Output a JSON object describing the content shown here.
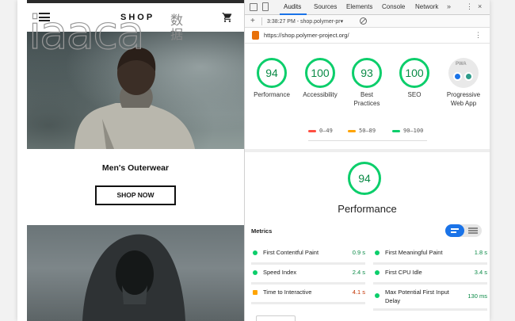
{
  "watermark": {
    "latin": "iaaca",
    "cn": "数\n据"
  },
  "shop": {
    "title": "SHOP",
    "product_name": "Men's Outerwear",
    "shop_now_label": "SHOP NOW"
  },
  "devtools": {
    "tabs": [
      "Audits",
      "Sources",
      "Elements",
      "Console",
      "Network"
    ],
    "more_tabs": "»",
    "menu": "⋮",
    "close": "×",
    "new_audit": "+",
    "audit_entry": "3:38:27 PM - shop.polymer-pr▾",
    "url": "https://shop.polymer-project.org/"
  },
  "scores": [
    {
      "label": "Performance",
      "value": "94"
    },
    {
      "label": "Accessibility",
      "value": "100"
    },
    {
      "label": "Best\nPractices",
      "value": "93"
    },
    {
      "label": "SEO",
      "value": "100"
    }
  ],
  "pwa": {
    "label": "Progressive\nWeb App",
    "badge": "PWA"
  },
  "legend": [
    {
      "range": "0–49",
      "color": "#ff4e42"
    },
    {
      "range": "50–89",
      "color": "#ffa400"
    },
    {
      "range": "90–100",
      "color": "#0cce6b"
    }
  ],
  "performance": {
    "score": "94",
    "title": "Performance"
  },
  "metrics_title": "Metrics",
  "metrics": [
    {
      "name": "First Contentful Paint",
      "value": "0.9 s",
      "status": "pass"
    },
    {
      "name": "First Meaningful Paint",
      "value": "1.8 s",
      "status": "pass"
    },
    {
      "name": "Speed Index",
      "value": "2.4 s",
      "status": "pass"
    },
    {
      "name": "First CPU Idle",
      "value": "3.4 s",
      "status": "pass"
    },
    {
      "name": "Time to Interactive",
      "value": "4.1 s",
      "status": "average"
    },
    {
      "name": "Max Potential First Input\nDelay",
      "value": "130 ms",
      "status": "pass"
    }
  ],
  "colors": {
    "pass": "#0cce6b",
    "pass_text": "#0a8a46",
    "average": "#ffa400",
    "average_text": "#c33300",
    "accent": "#1a73e8"
  }
}
